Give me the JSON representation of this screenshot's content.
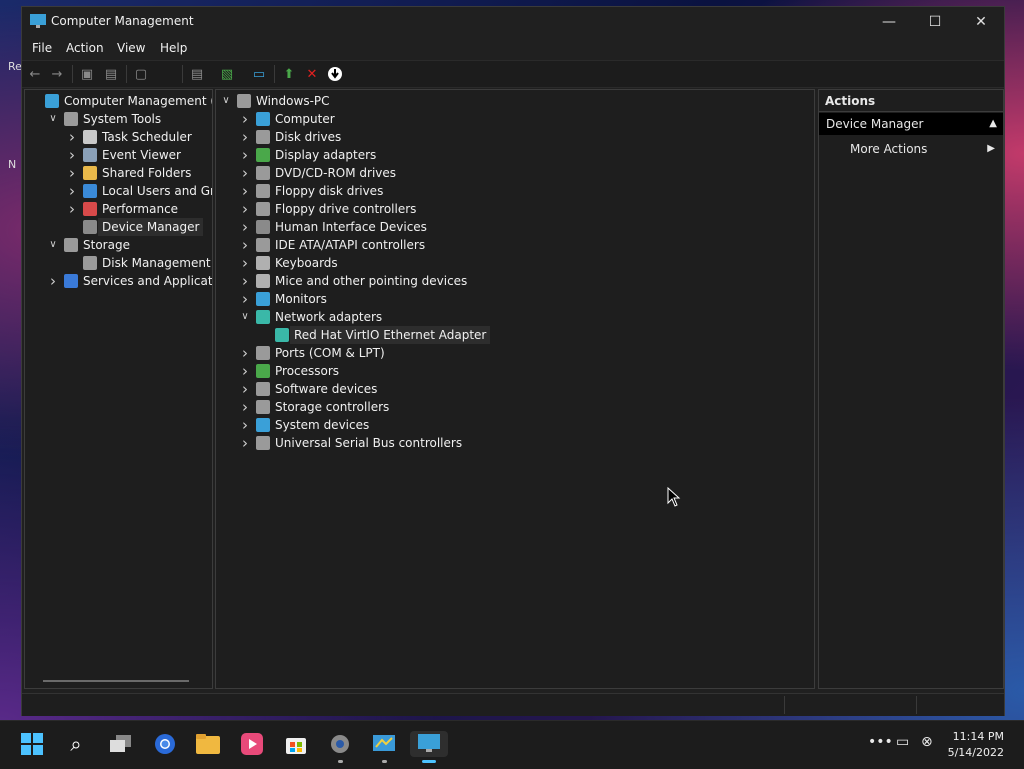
{
  "window": {
    "title": "Computer Management"
  },
  "menu": [
    "File",
    "Action",
    "View",
    "Help"
  ],
  "desktop_fragments": [
    "Re",
    "N"
  ],
  "left_tree": [
    {
      "label": "Computer Management (Loca",
      "level": 0,
      "expand": "",
      "icon": "computer-icon",
      "color": "#3aa0d8"
    },
    {
      "label": "System Tools",
      "level": 1,
      "expand": "open",
      "icon": "tools-icon",
      "color": "#9a9a9a"
    },
    {
      "label": "Task Scheduler",
      "level": 2,
      "expand": "closed",
      "icon": "clock-icon",
      "color": "#c8c8c8"
    },
    {
      "label": "Event Viewer",
      "level": 2,
      "expand": "closed",
      "icon": "event-viewer-icon",
      "color": "#8aa0b8"
    },
    {
      "label": "Shared Folders",
      "level": 2,
      "expand": "closed",
      "icon": "shared-folder-icon",
      "color": "#e8b84a"
    },
    {
      "label": "Local Users and Groups",
      "level": 2,
      "expand": "closed",
      "icon": "users-icon",
      "color": "#3a8ad8"
    },
    {
      "label": "Performance",
      "level": 2,
      "expand": "closed",
      "icon": "performance-icon",
      "color": "#d84a4a"
    },
    {
      "label": "Device Manager",
      "level": 2,
      "expand": "",
      "icon": "device-manager-icon",
      "color": "#8a8a8a",
      "selected": true
    },
    {
      "label": "Storage",
      "level": 1,
      "expand": "open",
      "icon": "storage-icon",
      "color": "#9a9a9a"
    },
    {
      "label": "Disk Management",
      "level": 2,
      "expand": "",
      "icon": "disk-icon",
      "color": "#9a9a9a"
    },
    {
      "label": "Services and Applications",
      "level": 1,
      "expand": "closed",
      "icon": "services-icon",
      "color": "#3a7ad8"
    }
  ],
  "device_tree": [
    {
      "label": "Windows-PC",
      "level": 0,
      "expand": "open",
      "icon": "computer-icon",
      "color": "#9a9a9a"
    },
    {
      "label": "Computer",
      "level": 1,
      "expand": "closed",
      "icon": "monitor-icon",
      "color": "#3aa0d8"
    },
    {
      "label": "Disk drives",
      "level": 1,
      "expand": "closed",
      "icon": "disk-drive-icon",
      "color": "#9a9a9a"
    },
    {
      "label": "Display adapters",
      "level": 1,
      "expand": "closed",
      "icon": "display-adapter-icon",
      "color": "#4aa84a"
    },
    {
      "label": "DVD/CD-ROM drives",
      "level": 1,
      "expand": "closed",
      "icon": "dvd-icon",
      "color": "#9a9a9a"
    },
    {
      "label": "Floppy disk drives",
      "level": 1,
      "expand": "closed",
      "icon": "floppy-icon",
      "color": "#9a9a9a"
    },
    {
      "label": "Floppy drive controllers",
      "level": 1,
      "expand": "closed",
      "icon": "floppy-controller-icon",
      "color": "#9a9a9a"
    },
    {
      "label": "Human Interface Devices",
      "level": 1,
      "expand": "closed",
      "icon": "hid-icon",
      "color": "#8a8a8a"
    },
    {
      "label": "IDE ATA/ATAPI controllers",
      "level": 1,
      "expand": "closed",
      "icon": "ide-icon",
      "color": "#9a9a9a"
    },
    {
      "label": "Keyboards",
      "level": 1,
      "expand": "closed",
      "icon": "keyboard-icon",
      "color": "#b0b0b0"
    },
    {
      "label": "Mice and other pointing devices",
      "level": 1,
      "expand": "closed",
      "icon": "mouse-icon",
      "color": "#b0b0b0"
    },
    {
      "label": "Monitors",
      "level": 1,
      "expand": "closed",
      "icon": "monitor-icon",
      "color": "#3aa0d8"
    },
    {
      "label": "Network adapters",
      "level": 1,
      "expand": "open",
      "icon": "network-adapter-icon",
      "color": "#3ab8a8"
    },
    {
      "label": "Red Hat VirtIO Ethernet Adapter",
      "level": 2,
      "expand": "",
      "icon": "network-adapter-icon",
      "color": "#3ab8a8",
      "selected": true
    },
    {
      "label": "Ports (COM & LPT)",
      "level": 1,
      "expand": "closed",
      "icon": "port-icon",
      "color": "#9a9a9a"
    },
    {
      "label": "Processors",
      "level": 1,
      "expand": "closed",
      "icon": "processor-icon",
      "color": "#4aa84a"
    },
    {
      "label": "Software devices",
      "level": 1,
      "expand": "closed",
      "icon": "software-device-icon",
      "color": "#9a9a9a"
    },
    {
      "label": "Storage controllers",
      "level": 1,
      "expand": "closed",
      "icon": "storage-controller-icon",
      "color": "#9a9a9a"
    },
    {
      "label": "System devices",
      "level": 1,
      "expand": "closed",
      "icon": "system-device-icon",
      "color": "#3aa0d8"
    },
    {
      "label": "Universal Serial Bus controllers",
      "level": 1,
      "expand": "closed",
      "icon": "usb-icon",
      "color": "#9a9a9a"
    }
  ],
  "actions": {
    "header": "Actions",
    "section": "Device Manager",
    "items": [
      "More Actions"
    ]
  },
  "clock": {
    "time": "11:14 PM",
    "date": "5/14/2022"
  }
}
